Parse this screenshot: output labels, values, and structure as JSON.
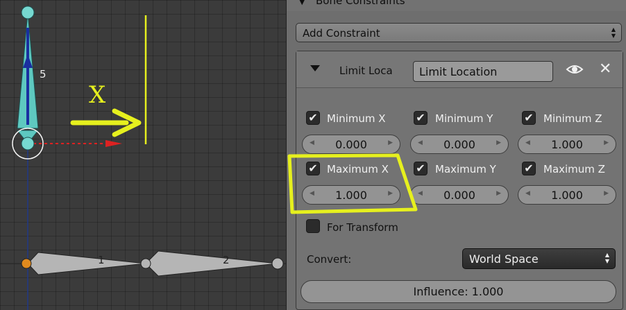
{
  "viewport": {
    "bone_label_5": "5",
    "bone_label_1": "1",
    "bone_label_2": "2",
    "annotation_axis": "X",
    "colors": {
      "annotation": "#e6f01e",
      "bone_selected": "#5ec8c0",
      "bone_default": "#b5b5b5",
      "x_axis": "#dd2222"
    }
  },
  "panel": {
    "header_title": "Bone Constraints",
    "add_constraint_label": "Add Constraint",
    "constraint": {
      "type_label": "Limit Loca",
      "name_value": "Limit Location",
      "min_x": {
        "label": "Minimum X",
        "checked": true,
        "value": "0.000"
      },
      "min_y": {
        "label": "Minimum Y",
        "checked": true,
        "value": "0.000"
      },
      "min_z": {
        "label": "Minimum Z",
        "checked": true,
        "value": "1.000"
      },
      "max_x": {
        "label": "Maximum X",
        "checked": true,
        "value": "1.000"
      },
      "max_y": {
        "label": "Maximum Y",
        "checked": true,
        "value": "0.000"
      },
      "max_z": {
        "label": "Maximum Z",
        "checked": true,
        "value": "1.000"
      },
      "for_transform": {
        "label": "For Transform",
        "checked": false
      },
      "convert_label": "Convert:",
      "convert_value": "World Space",
      "influence": "Influence: 1.000"
    },
    "check_glyph": "✔"
  }
}
